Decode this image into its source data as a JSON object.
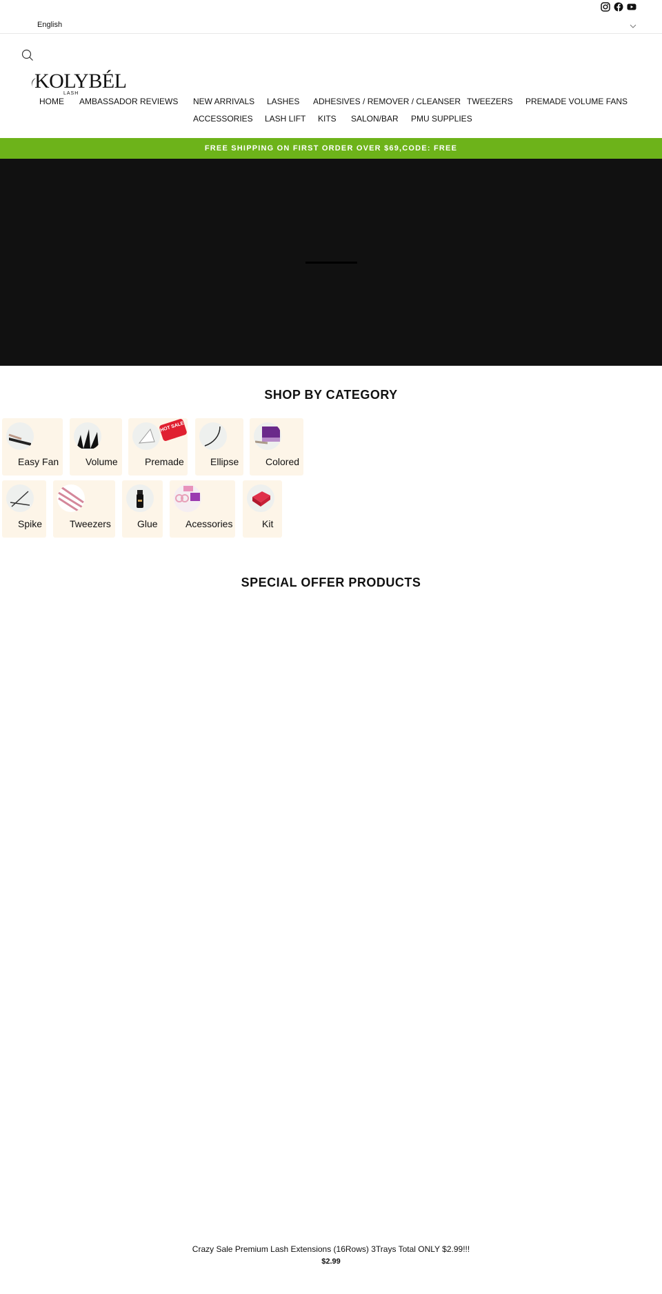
{
  "topbar": {
    "language": "English",
    "social": [
      "instagram-icon",
      "facebook-icon",
      "youtube-icon"
    ]
  },
  "logo": {
    "name": "KOLYBÉL",
    "tagline": "LASH"
  },
  "nav": {
    "row1": [
      "HOME",
      "AMBASSADOR REVIEWS",
      "NEW ARRIVALS",
      "LASHES",
      "ADHESIVES / REMOVER / CLEANSER",
      "TWEEZERS",
      "PREMADE VOLUME FANS"
    ],
    "row2": [
      "ACCESSORIES",
      "LASH LIFT",
      "KITS",
      "SALON/BAR",
      "PMU SUPPLIES"
    ]
  },
  "promo": {
    "text": "FREE SHIPPING ON FIRST ORDER OVER $69,CODE: FREE",
    "color": "#6db31a"
  },
  "categories": {
    "title": "SHOP BY CATEGORY",
    "hot_badge": "HOT SALE",
    "row1": [
      "Easy Fan",
      "Volume",
      "Premade",
      "Ellipse",
      "Colored"
    ],
    "row2": [
      "Spike",
      "Tweezers",
      "Glue",
      "Acessories",
      "Kit"
    ]
  },
  "special_offer": {
    "title": "SPECIAL OFFER PRODUCTS",
    "product": {
      "title": "Crazy Sale Premium Lash Extensions (16Rows) 3Trays Total ONLY $2.99!!!",
      "price": "$2.99"
    }
  }
}
